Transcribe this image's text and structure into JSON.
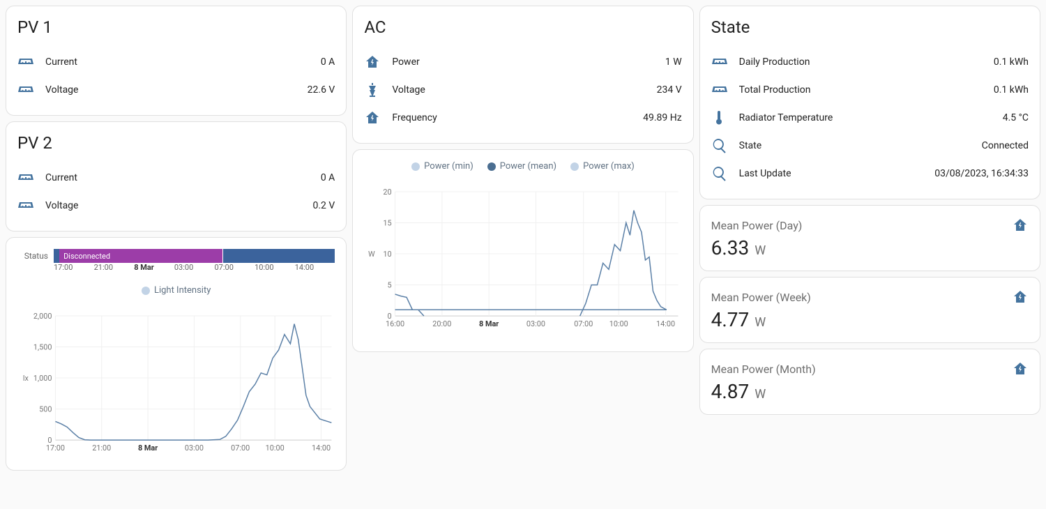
{
  "pv1": {
    "title": "PV 1",
    "current": {
      "label": "Current",
      "value": "0 A"
    },
    "voltage": {
      "label": "Voltage",
      "value": "22.6 V"
    }
  },
  "pv2": {
    "title": "PV 2",
    "current": {
      "label": "Current",
      "value": "0 A"
    },
    "voltage": {
      "label": "Voltage",
      "value": "0.2 V"
    }
  },
  "ac": {
    "title": "AC",
    "power": {
      "label": "Power",
      "value": "1 W"
    },
    "voltage": {
      "label": "Voltage",
      "value": "234 V"
    },
    "frequency": {
      "label": "Frequency",
      "value": "49.89 Hz"
    }
  },
  "state": {
    "title": "State",
    "daily": {
      "label": "Daily Production",
      "value": "0.1 kWh"
    },
    "total": {
      "label": "Total Production",
      "value": "0.1 kWh"
    },
    "radiator": {
      "label": "Radiator Temperature",
      "value": "4.5 °C"
    },
    "status": {
      "label": "State",
      "value": "Connected"
    },
    "update": {
      "label": "Last Update",
      "value": "03/08/2023, 16:34:33"
    }
  },
  "mean_power": {
    "day": {
      "title": "Mean Power (Day)",
      "value": "6.33",
      "unit": "W"
    },
    "week": {
      "title": "Mean Power (Week)",
      "value": "4.77",
      "unit": "W"
    },
    "month": {
      "title": "Mean Power (Month)",
      "value": "4.87",
      "unit": "W"
    }
  },
  "status_timeline": {
    "label": "Status",
    "disconnected_label": "Disconnected",
    "ticks": [
      "17:00",
      "21:00",
      "8 Mar",
      "03:00",
      "07:00",
      "10:00",
      "14:00"
    ]
  },
  "light_chart": {
    "legend": "Light Intensity",
    "ylabel": "lx",
    "yticks": [
      "0",
      "500",
      "1,000",
      "1,500",
      "2,000"
    ],
    "xticks": [
      "17:00",
      "21:00",
      "8 Mar",
      "03:00",
      "07:00",
      "10:00",
      "14:00"
    ]
  },
  "power_chart": {
    "legend_min": "Power (min)",
    "legend_mean": "Power (mean)",
    "legend_max": "Power (max)",
    "ylabel": "W",
    "yticks": [
      "0",
      "5",
      "10",
      "15",
      "20"
    ],
    "xticks": [
      "16:00",
      "20:00",
      "8 Mar",
      "03:00",
      "07:00",
      "10:00",
      "14:00"
    ]
  },
  "colors": {
    "icon": "#44739e",
    "status_disconnected": "#9c3da8",
    "status_connected": "#3b639c",
    "chart_line": "#5a7fa6"
  },
  "chart_data": [
    {
      "type": "timeline",
      "title": "Status",
      "x_range_hours": [
        "17:00",
        "16:30+1d"
      ],
      "segments": [
        {
          "state": "Connected",
          "start": "17:00",
          "end": "17:15"
        },
        {
          "state": "Disconnected",
          "start": "17:15",
          "end": "07:05"
        },
        {
          "state": "Connected",
          "start": "07:05",
          "end": "16:30"
        }
      ]
    },
    {
      "type": "line",
      "title": "Light Intensity",
      "ylabel": "lx",
      "ylim": [
        0,
        2000
      ],
      "x_range_hours": [
        "17:00",
        "16:30+1d"
      ],
      "series": [
        {
          "name": "Light Intensity",
          "points": [
            [
              "17:00",
              300
            ],
            [
              "17:30",
              260
            ],
            [
              "18:00",
              210
            ],
            [
              "18:30",
              120
            ],
            [
              "19:00",
              40
            ],
            [
              "19:30",
              5
            ],
            [
              "20:00",
              0
            ],
            [
              "22:00",
              0
            ],
            [
              "00:00",
              0
            ],
            [
              "02:00",
              0
            ],
            [
              "04:00",
              0
            ],
            [
              "06:00",
              0
            ],
            [
              "07:00",
              10
            ],
            [
              "07:30",
              60
            ],
            [
              "08:00",
              180
            ],
            [
              "08:30",
              320
            ],
            [
              "09:00",
              540
            ],
            [
              "09:30",
              780
            ],
            [
              "10:00",
              900
            ],
            [
              "10:30",
              1080
            ],
            [
              "11:00",
              1050
            ],
            [
              "11:30",
              1320
            ],
            [
              "12:00",
              1450
            ],
            [
              "12:30",
              1700
            ],
            [
              "13:00",
              1550
            ],
            [
              "13:20",
              1870
            ],
            [
              "13:40",
              1620
            ],
            [
              "14:00",
              1180
            ],
            [
              "14:20",
              720
            ],
            [
              "14:40",
              540
            ],
            [
              "15:00",
              460
            ],
            [
              "15:30",
              340
            ],
            [
              "16:00",
              310
            ],
            [
              "16:30",
              280
            ]
          ]
        }
      ]
    },
    {
      "type": "line",
      "title": "AC Power",
      "ylabel": "W",
      "ylim": [
        0,
        20
      ],
      "x_range_hours": [
        "16:00",
        "16:30+1d"
      ],
      "series": [
        {
          "name": "Power (mean)",
          "points": [
            [
              "16:00",
              3.5
            ],
            [
              "16:30",
              3.2
            ],
            [
              "17:00",
              3.0
            ],
            [
              "17:30",
              1.0
            ],
            [
              "18:00",
              1.0
            ],
            [
              "18:30",
              0
            ],
            [
              "08:00",
              0
            ],
            [
              "08:30",
              2.0
            ],
            [
              "09:00",
              5.0
            ],
            [
              "09:30",
              5.0
            ],
            [
              "10:00",
              8.5
            ],
            [
              "10:30",
              7.5
            ],
            [
              "11:00",
              11.5
            ],
            [
              "11:30",
              10.5
            ],
            [
              "12:00",
              15.0
            ],
            [
              "12:20",
              13.0
            ],
            [
              "12:40",
              17.0
            ],
            [
              "13:00",
              15.0
            ],
            [
              "13:20",
              13.5
            ],
            [
              "13:40",
              9.0
            ],
            [
              "14:00",
              9.5
            ],
            [
              "14:20",
              4.0
            ],
            [
              "14:40",
              2.5
            ],
            [
              "15:00",
              1.5
            ],
            [
              "15:30",
              1.0
            ],
            [
              "16:00",
              1.0
            ],
            [
              "16:30",
              1.0
            ]
          ]
        }
      ]
    }
  ]
}
